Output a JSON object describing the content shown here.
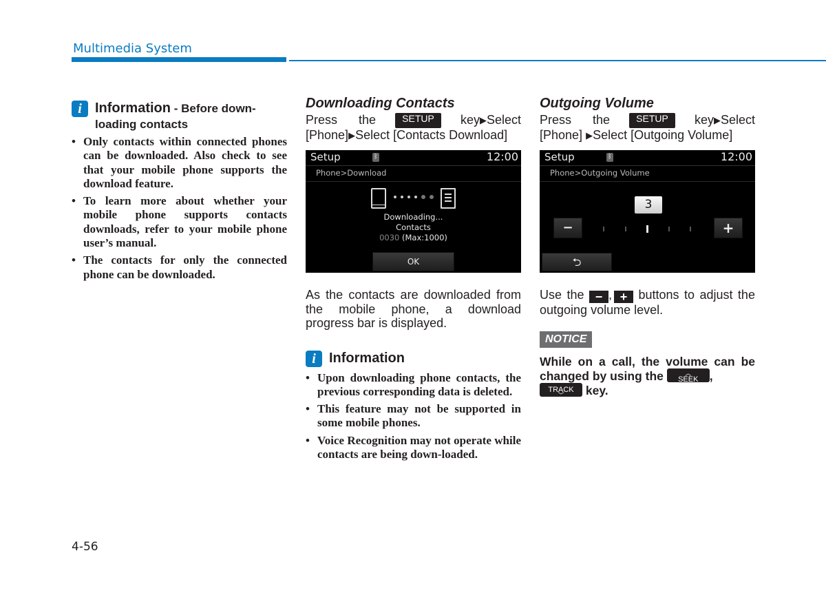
{
  "header": {
    "section_title": "Multimedia System",
    "accent_color": "#0a7cc1"
  },
  "page_number": "4-56",
  "column1": {
    "info_icon": "info-icon",
    "info_title": "Information",
    "info_subtitle_line1": " - Before down-",
    "info_subtitle_line2": "loading contacts",
    "bullets": [
      "Only contacts within connected phones can be downloaded. Also check to see that your mobile phone supports the download feature.",
      "To learn more about whether your mobile phone supports contacts downloads, refer to your mobile phone user’s manual.",
      "The contacts for only the connected phone can be downloaded."
    ]
  },
  "column2": {
    "section_title": "Downloading Contacts",
    "instr_press": "Press the",
    "instr_key": "SETUP",
    "instr_after_key": "key",
    "instr_select1": "Select",
    "instr_phone": "[Phone]",
    "instr_select2": "Select [Contacts Download]",
    "screen": {
      "title": "Setup",
      "time": "12:00",
      "breadcrumb": "Phone>Download",
      "status_line1": "Downloading...",
      "status_line2": "Contacts",
      "count": "0030",
      "max": " (Max:1000)",
      "ok_button": "OK",
      "progress_dots_done": 4,
      "progress_dots_total": 6
    },
    "description": "As the contacts are downloaded from the mobile phone, a download progress bar is displayed.",
    "info_title": "Information",
    "bullets": [
      "Upon downloading phone contacts, the previous corresponding data is deleted.",
      "This feature may not be supported in some mobile phones.",
      "Voice Recognition may not operate while contacts are being down-loaded."
    ]
  },
  "column3": {
    "section_title": "Outgoing Volume",
    "instr_press": "Press the",
    "instr_key": "SETUP",
    "instr_after_key": "key",
    "instr_select1": "Select",
    "instr_phone": "[Phone]",
    "instr_select2": "Select [Outgoing Volume]",
    "screen": {
      "title": "Setup",
      "time": "12:00",
      "breadcrumb": "Phone>Outgoing Volume",
      "volume_value": "3",
      "volume_level": 3,
      "volume_steps": 5,
      "minus_label": "−",
      "plus_label": "+",
      "back_icon": "back-arrow-icon"
    },
    "desc_use_the": "Use the",
    "desc_minus": "−",
    "desc_plus": "+",
    "desc_rest": "buttons to adjust the outgoing volume level.",
    "notice_label": "NOTICE",
    "notice_text_1": "While on a call, the volume can be changed by using the",
    "seek_key": "SEEK",
    "track_key": "TRACK",
    "notice_text_2": "key."
  }
}
